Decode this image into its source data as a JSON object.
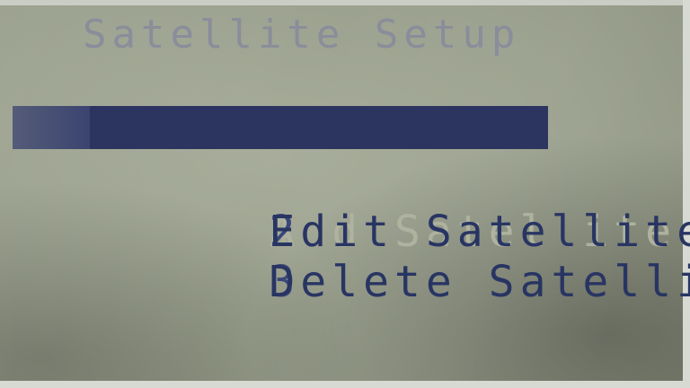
{
  "screen": {
    "title": "Satellite Setup"
  },
  "menu": {
    "items": [
      {
        "number": "1",
        "label": "Add Satellite",
        "selected": true
      },
      {
        "number": "2",
        "label": "Edit Satellite",
        "selected": false
      },
      {
        "number": "3",
        "label": "Delete Satellite",
        "selected": false
      }
    ]
  },
  "colors": {
    "lcd_background": "#9aa08d",
    "text": "#283563",
    "title_text": "#8a8d9a",
    "highlight_bar": "#2c3560",
    "highlight_text": "#a9ad9a"
  }
}
